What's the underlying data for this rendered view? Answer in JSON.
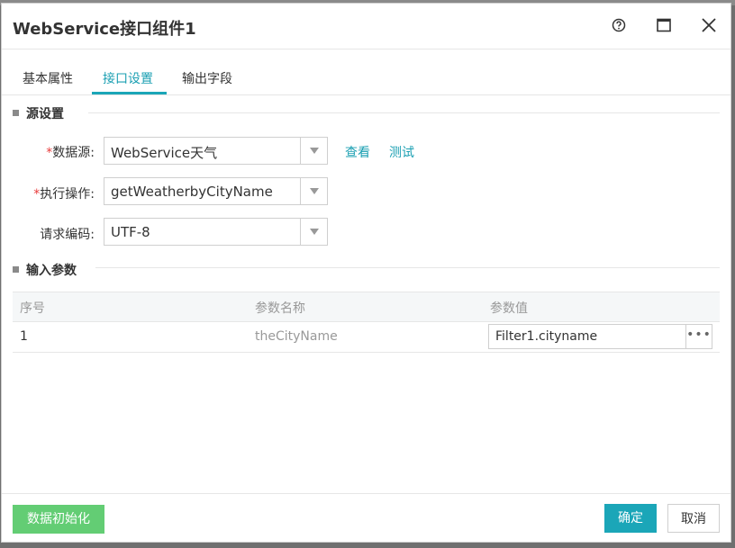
{
  "dialog": {
    "title": "WebService接口组件1"
  },
  "tabs": [
    {
      "label": "基本属性"
    },
    {
      "label": "接口设置"
    },
    {
      "label": "输出字段"
    }
  ],
  "source": {
    "section_title": "源设置",
    "datasource": {
      "required_mark": "*",
      "label": "数据源:",
      "value": "WebService天气"
    },
    "operation": {
      "required_mark": "*",
      "label": "执行操作:",
      "value": "getWeatherbyCityName"
    },
    "encoding": {
      "label": "请求编码:",
      "value": "UTF-8"
    },
    "view_link": "查看",
    "test_link": "测试"
  },
  "params": {
    "section_title": "输入参数",
    "columns": [
      "序号",
      "参数名称",
      "参数值"
    ],
    "rows": [
      {
        "index": "1",
        "name": "theCityName",
        "value": "Filter1.cityname",
        "more": "•••"
      }
    ]
  },
  "footer": {
    "init_button": "数据初始化",
    "ok_button": "确定",
    "cancel_button": "取消"
  },
  "colors": {
    "accent": "#1ba6b8",
    "init_button": "#63cd74",
    "required": "#e83b3b"
  }
}
